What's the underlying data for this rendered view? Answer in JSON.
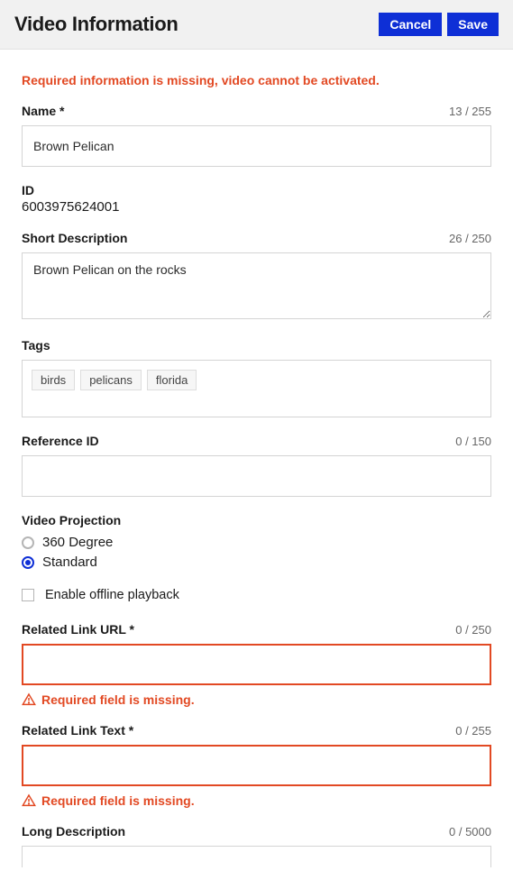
{
  "header": {
    "title": "Video Information",
    "cancel": "Cancel",
    "save": "Save"
  },
  "banner": "Required information is missing, video cannot be activated.",
  "fields": {
    "name": {
      "label": "Name *",
      "value": "Brown Pelican",
      "count": "13 / 255"
    },
    "id": {
      "label": "ID",
      "value": "6003975624001"
    },
    "shortDescription": {
      "label": "Short Description",
      "value": "Brown Pelican on the rocks",
      "count": "26 / 250"
    },
    "tags": {
      "label": "Tags",
      "items": [
        "birds",
        "pelicans",
        "florida"
      ]
    },
    "referenceId": {
      "label": "Reference ID",
      "value": "",
      "count": "0 / 150"
    },
    "videoProjection": {
      "label": "Video Projection",
      "options": {
        "deg360": "360 Degree",
        "standard": "Standard"
      },
      "selected": "standard"
    },
    "offlinePlayback": {
      "label": "Enable offline playback",
      "checked": false
    },
    "relatedLinkUrl": {
      "label": "Related Link URL *",
      "value": "",
      "count": "0 / 250",
      "error": "Required field is missing."
    },
    "relatedLinkText": {
      "label": "Related Link Text *",
      "value": "",
      "count": "0 / 255",
      "error": "Required field is missing."
    },
    "longDescription": {
      "label": "Long Description",
      "value": "",
      "count": "0 / 5000"
    }
  }
}
